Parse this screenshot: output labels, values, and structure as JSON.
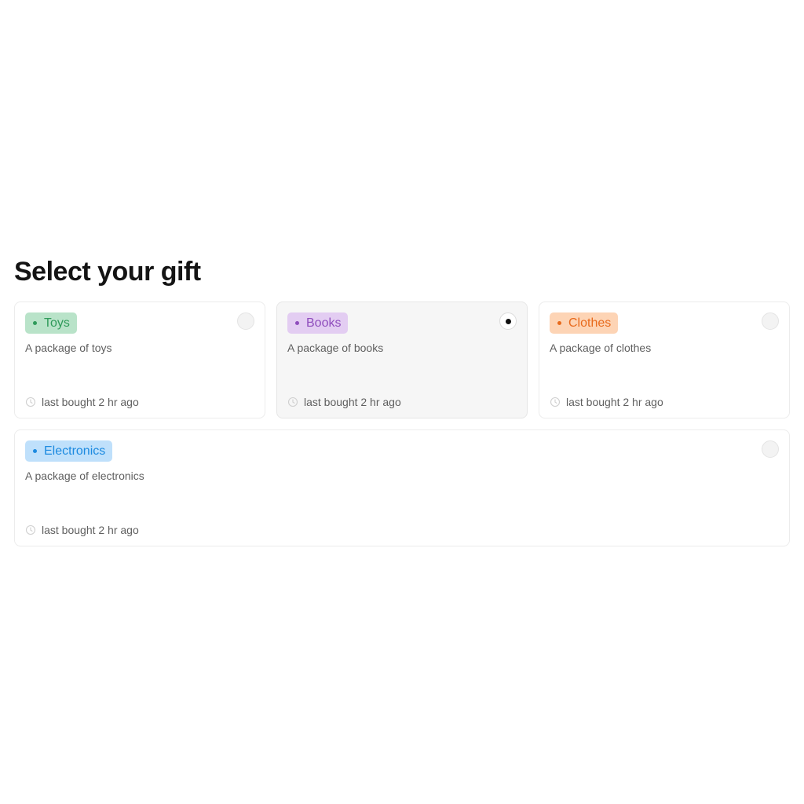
{
  "heading": "Select your gift",
  "options": [
    {
      "tag": "Toys",
      "description": "A package of toys",
      "meta": "last bought 2 hr ago",
      "selected": false,
      "tag_bg": "#b9e3c9",
      "tag_color": "#2f9a5a"
    },
    {
      "tag": "Books",
      "description": "A package of books",
      "meta": "last bought 2 hr ago",
      "selected": true,
      "tag_bg": "#e3cdf2",
      "tag_color": "#8f4dbd"
    },
    {
      "tag": "Clothes",
      "description": "A package of clothes",
      "meta": "last bought 2 hr ago",
      "selected": false,
      "tag_bg": "#fdd4b5",
      "tag_color": "#e86a1c"
    },
    {
      "tag": "Electronics",
      "description": "A package of electronics",
      "meta": "last bought 2 hr ago",
      "selected": false,
      "tag_bg": "#bfe0fb",
      "tag_color": "#1c8ae0"
    }
  ],
  "icons": {
    "meta_icon": "clock-icon",
    "bullet_icon": "dot-icon"
  }
}
